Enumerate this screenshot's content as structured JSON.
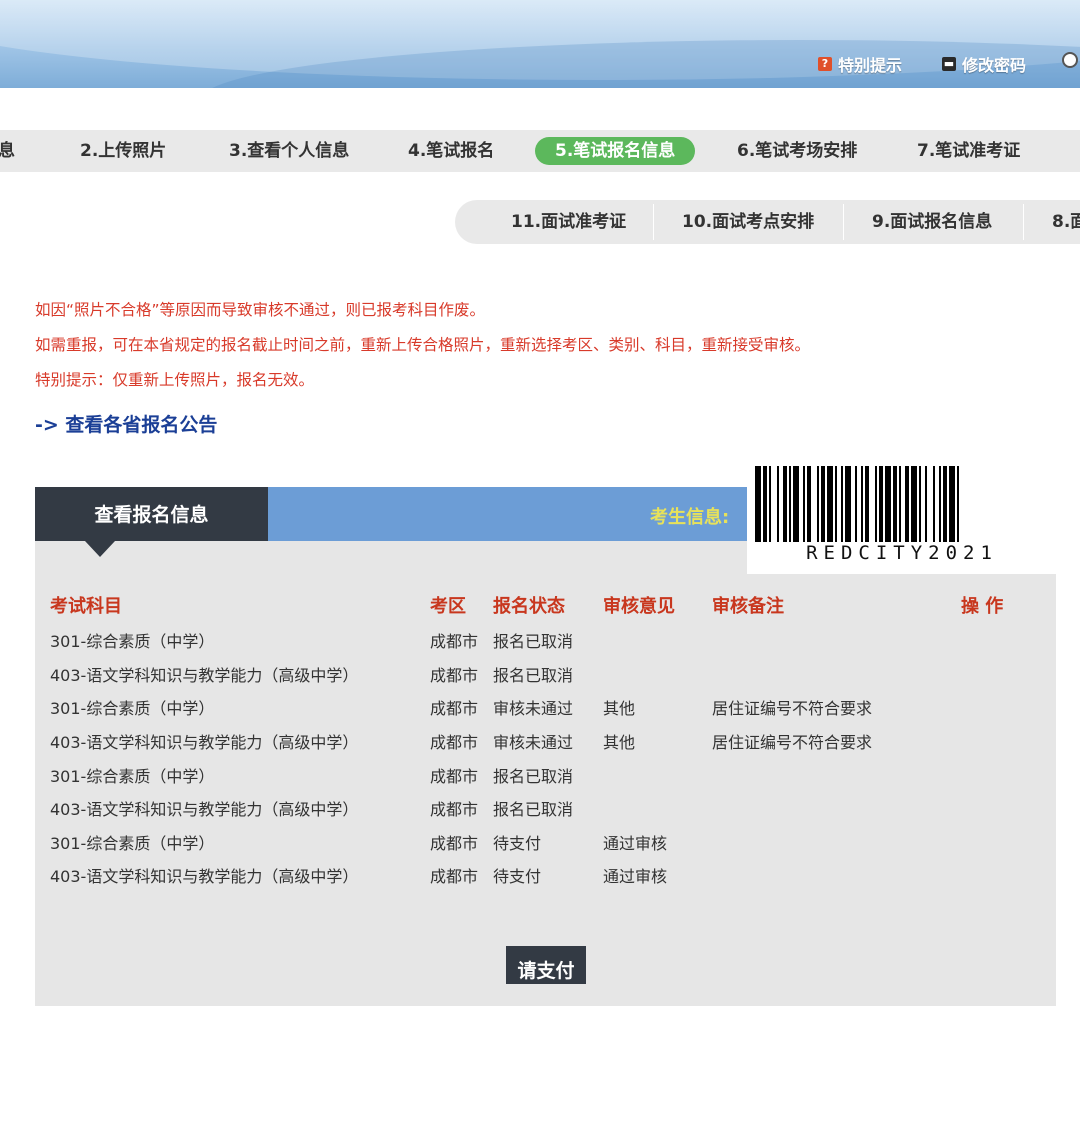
{
  "header": {
    "special_notice_label": "特别提示",
    "change_password_label": "修改密码"
  },
  "steps_row1": [
    "息",
    "2.上传照片",
    "3.查看个人信息",
    "4.笔试报名",
    "5.笔试报名信息",
    "6.笔试考场安排",
    "7.笔试准考证"
  ],
  "steps_row2": [
    "11.面试准考证",
    "10.面试考点安排",
    "9.面试报名信息",
    "8.面"
  ],
  "active_step": "5.笔试报名信息",
  "notices": [
    "如因“照片不合格”等原因而导致审核不通过，则已报考科目作废。",
    "如需重报，可在本省规定的报名截止时间之前，重新上传合格照片，重新选择考区、类别、科目，重新接受审核。",
    "特别提示：仅重新上传照片，报名无效。"
  ],
  "announcement_link": "-> 查看各省报名公告",
  "panel": {
    "title": "查看报名信息",
    "candidate_info_label": "考生信息:",
    "barcode_text": "REDCITY2021",
    "columns": [
      "考试科目",
      "考区",
      "报名状态",
      "审核意见",
      "审核备注",
      "操 作"
    ],
    "rows": [
      [
        "301-综合素质（中学）",
        "成都市",
        "报名已取消",
        "",
        "",
        ""
      ],
      [
        "403-语文学科知识与教学能力（高级中学）",
        "成都市",
        "报名已取消",
        "",
        "",
        ""
      ],
      [
        "301-综合素质（中学）",
        "成都市",
        "审核未通过",
        "其他",
        "居住证编号不符合要求",
        ""
      ],
      [
        "403-语文学科知识与教学能力（高级中学）",
        "成都市",
        "审核未通过",
        "其他",
        "居住证编号不符合要求",
        ""
      ],
      [
        "301-综合素质（中学）",
        "成都市",
        "报名已取消",
        "",
        "",
        ""
      ],
      [
        "403-语文学科知识与教学能力（高级中学）",
        "成都市",
        "报名已取消",
        "",
        "",
        ""
      ],
      [
        "301-综合素质（中学）",
        "成都市",
        "待支付",
        "通过审核",
        "",
        ""
      ],
      [
        "403-语文学科知识与教学能力（高级中学）",
        "成都市",
        "待支付",
        "通过审核",
        "",
        ""
      ]
    ],
    "pay_button": "请支付"
  },
  "colors": {
    "active_step": "#5cb85c",
    "notice_text": "#d83a2a",
    "link": "#1b3f96",
    "panel_header": "#6c9dd6",
    "panel_tab": "#333a44",
    "column_header": "#c8371e",
    "candidate_label": "#e8e25a"
  }
}
